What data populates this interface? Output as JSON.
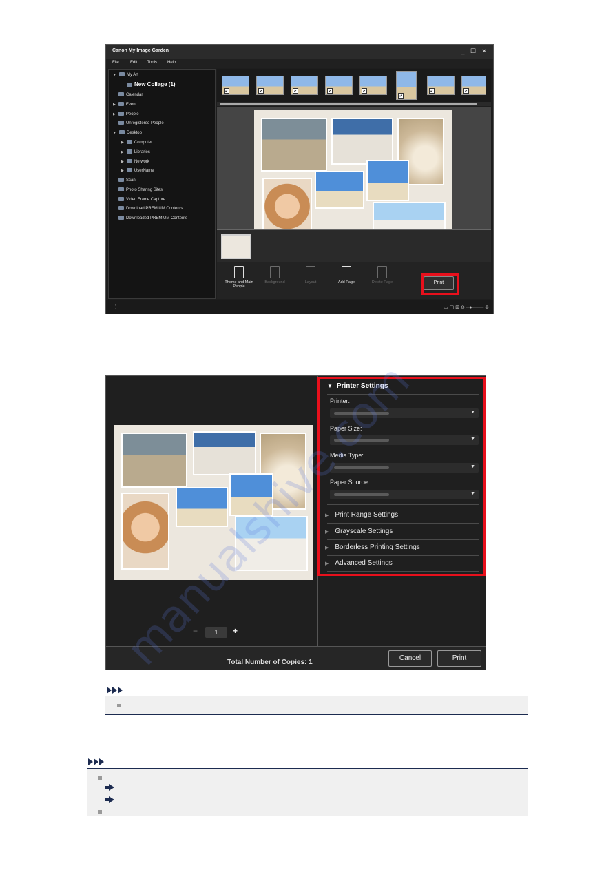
{
  "window1": {
    "title": "Canon My Image Garden",
    "window_controls": "_ ☐ ✕",
    "menu": [
      "File",
      "Edit",
      "Tools",
      "Help"
    ],
    "tree": [
      {
        "label": "My Art",
        "arrow": "▼",
        "icon": "my-art-icon"
      },
      {
        "label": "New Collage (1)",
        "icon": "collage-icon"
      },
      {
        "label": "Calendar",
        "icon": "calendar-icon"
      },
      {
        "label": "Event",
        "arrow": "▶",
        "icon": "event-icon"
      },
      {
        "label": "People",
        "arrow": "▶",
        "icon": "people-icon"
      },
      {
        "label": "Unregistered People",
        "icon": "person-icon"
      },
      {
        "label": "Desktop",
        "arrow": "▼",
        "icon": "desktop-icon"
      },
      {
        "label": "Computer",
        "arrow": "▶",
        "icon": "computer-icon"
      },
      {
        "label": "Libraries",
        "arrow": "▶",
        "icon": "libraries-icon"
      },
      {
        "label": "Network",
        "arrow": "▶",
        "icon": "network-icon"
      },
      {
        "label": "UserName",
        "arrow": "▶",
        "icon": "user-folder-icon"
      },
      {
        "label": "Scan",
        "icon": "scan-icon"
      },
      {
        "label": "Photo Sharing Sites",
        "icon": "photo-sharing-icon"
      },
      {
        "label": "Video Frame Capture",
        "icon": "video-icon"
      },
      {
        "label": "Download PREMIUM Contents",
        "icon": "download-icon"
      },
      {
        "label": "Downloaded PREMIUM Contents",
        "icon": "folder-icon"
      }
    ],
    "checkmark": "✔",
    "toolbar": {
      "theme": "Theme and Main People",
      "background": "Background",
      "layout": "Layout",
      "add_page": "Add Page",
      "delete_page": "Delete Page",
      "print": "Print"
    },
    "status_more": "⋮",
    "zoom_glyphs": "▭ ▢ ⊞ ⊖ ━●━━━━ ⊕"
  },
  "dialog2": {
    "printer_settings": {
      "header": "Printer Settings",
      "printer_label": "Printer:",
      "paper_size_label": "Paper Size:",
      "media_type_label": "Media Type:",
      "paper_source_label": "Paper Source:"
    },
    "sections": [
      "Print Range Settings",
      "Grayscale Settings",
      "Borderless Printing Settings",
      "Advanced Settings"
    ],
    "pager": {
      "value": "1",
      "minus": "−",
      "plus": "+"
    },
    "copies_label": "Total Number of Copies:",
    "copies_value": "1",
    "cancel": "Cancel",
    "print": "Print"
  },
  "watermark": "manualshive.com",
  "colors": {
    "highlight": "#e8101c",
    "note_accent": "#1c2b50"
  }
}
